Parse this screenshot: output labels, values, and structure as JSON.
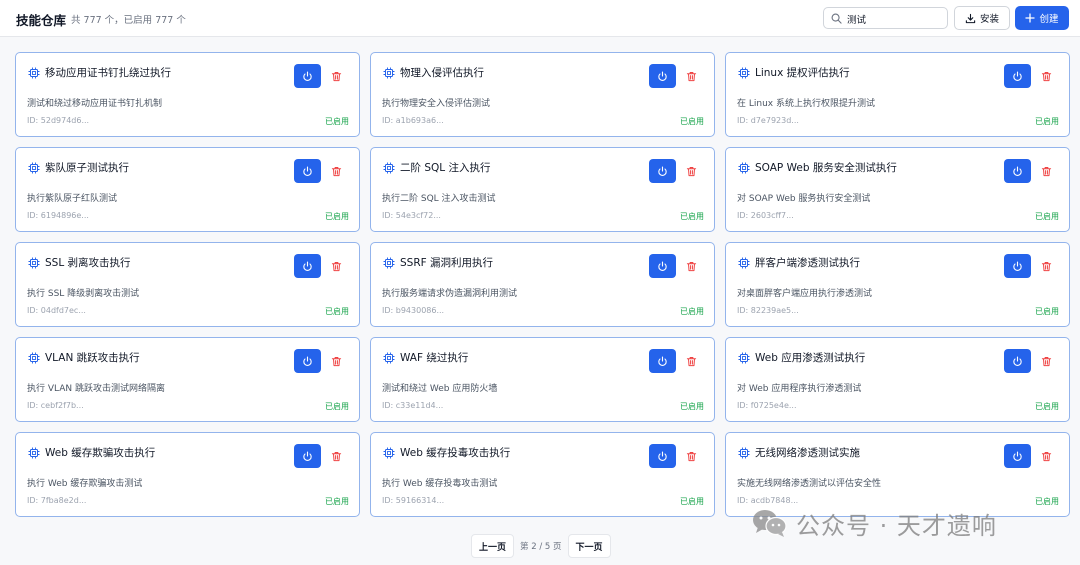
{
  "header": {
    "title": "技能仓库",
    "count": "共 777 个，已启用 777 个",
    "search_value": "测试",
    "install_label": "安装",
    "create_label": "创建"
  },
  "skills": [
    {
      "name": "移动应用证书钉扎绕过执行",
      "desc": "测试和绕过移动应用证书钉扎机制",
      "id": "ID: 52d974d6...",
      "status": "已启用"
    },
    {
      "name": "物理入侵评估执行",
      "desc": "执行物理安全入侵评估测试",
      "id": "ID: a1b693a6...",
      "status": "已启用"
    },
    {
      "name": "Linux 提权评估执行",
      "desc": "在 Linux 系统上执行权限提升测试",
      "id": "ID: d7e7923d...",
      "status": "已启用"
    },
    {
      "name": "紫队原子测试执行",
      "desc": "执行紫队原子红队测试",
      "id": "ID: 6194896e...",
      "status": "已启用"
    },
    {
      "name": "二阶 SQL 注入执行",
      "desc": "执行二阶 SQL 注入攻击测试",
      "id": "ID: 54e3cf72...",
      "status": "已启用"
    },
    {
      "name": "SOAP Web 服务安全测试执行",
      "desc": "对 SOAP Web 服务执行安全测试",
      "id": "ID: 2603cff7...",
      "status": "已启用"
    },
    {
      "name": "SSL 剥离攻击执行",
      "desc": "执行 SSL 降级剥离攻击测试",
      "id": "ID: 04dfd7ec...",
      "status": "已启用"
    },
    {
      "name": "SSRF 漏洞利用执行",
      "desc": "执行服务端请求伪造漏洞利用测试",
      "id": "ID: b9430086...",
      "status": "已启用"
    },
    {
      "name": "胖客户端渗透测试执行",
      "desc": "对桌面胖客户端应用执行渗透测试",
      "id": "ID: 82239ae5...",
      "status": "已启用"
    },
    {
      "name": "VLAN 跳跃攻击执行",
      "desc": "执行 VLAN 跳跃攻击测试网络隔离",
      "id": "ID: cebf2f7b...",
      "status": "已启用"
    },
    {
      "name": "WAF 绕过执行",
      "desc": "测试和绕过 Web 应用防火墙",
      "id": "ID: c33e11d4...",
      "status": "已启用"
    },
    {
      "name": "Web 应用渗透测试执行",
      "desc": "对 Web 应用程序执行渗透测试",
      "id": "ID: f0725e4e...",
      "status": "已启用"
    },
    {
      "name": "Web 缓存欺骗攻击执行",
      "desc": "执行 Web 缓存欺骗攻击测试",
      "id": "ID: 7fba8e2d...",
      "status": "已启用"
    },
    {
      "name": "Web 缓存投毒攻击执行",
      "desc": "执行 Web 缓存投毒攻击测试",
      "id": "ID: 59166314...",
      "status": "已启用"
    },
    {
      "name": "无线网络渗透测试实施",
      "desc": "实施无线网络渗透测试以评估安全性",
      "id": "ID: acdb7848...",
      "status": "已启用"
    }
  ],
  "pagination": {
    "prev_label": "上一页",
    "info": "第 2 / 5 页",
    "next_label": "下一页"
  },
  "watermark": "公众号 · 天才遗响",
  "colors": {
    "accent": "#2563eb",
    "card_border": "#93b4ec",
    "enabled": "#16a34a",
    "delete": "#ef4444"
  }
}
